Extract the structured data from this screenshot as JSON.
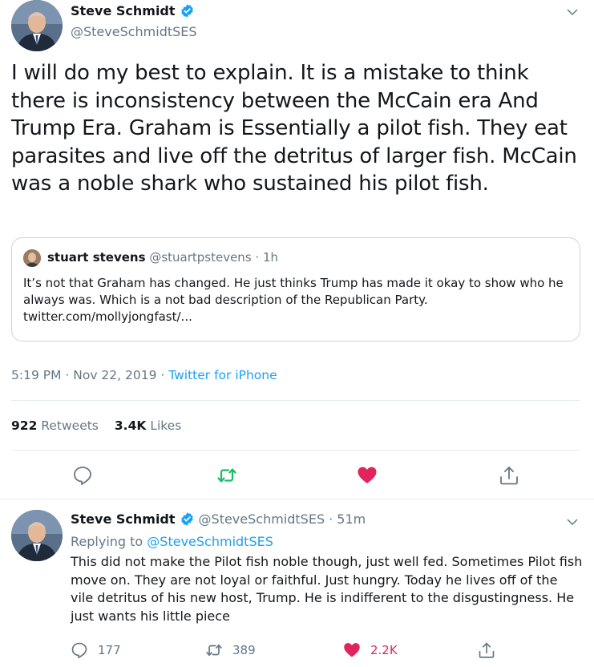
{
  "main_tweet": {
    "author_name": "Steve Schmidt",
    "author_handle": "@SteveSchmidtSES",
    "text": "I will do my best to explain. It is a mistake to think there is inconsistency between the McCain era And Trump Era. Graham is Essentially a pilot fish.  They eat parasites and live off the detritus of larger fish.  McCain was a noble shark who sustained his pilot fish.",
    "quoted": {
      "author_name": "stuart stevens",
      "author_handle": "@stuartpstevens",
      "time": "· 1h",
      "text": "It’s not that Graham has changed. He just thinks Trump has made it okay to show who he always was. Which is a not bad description of the Republican Party.",
      "link": "twitter.com/mollyjongfast/..."
    },
    "timestamp": "5:19 PM · Nov 22, 2019 · ",
    "source": "Twitter for iPhone",
    "retweets_count": "922",
    "retweets_label": "Retweets",
    "likes_count": "3.4K",
    "likes_label": "Likes"
  },
  "reply_tweet": {
    "author_name": "Steve Schmidt",
    "author_handle": "@SteveSchmidtSES",
    "time": "· 51m",
    "replying_label": "Replying to ",
    "replying_to": "@SteveSchmidtSES",
    "text": "This did not make the Pilot fish noble though, just well fed. Sometimes Pilot fish move on.  They are not loyal or faithful. Just hungry. Today he lives off of the vile detritus of his new host, Trump. He is indifferent to the disgustingness. He just wants his little piece",
    "replies": "177",
    "retweets": "389",
    "likes": "2.2K"
  },
  "colors": {
    "accent": "#1da1f2",
    "retweet_green": "#17bf63",
    "like_red": "#e0245e",
    "muted": "#657786"
  },
  "icons": [
    "verified-badge-icon",
    "chevron-down-icon",
    "reply-icon",
    "retweet-icon",
    "like-icon",
    "share-icon"
  ]
}
